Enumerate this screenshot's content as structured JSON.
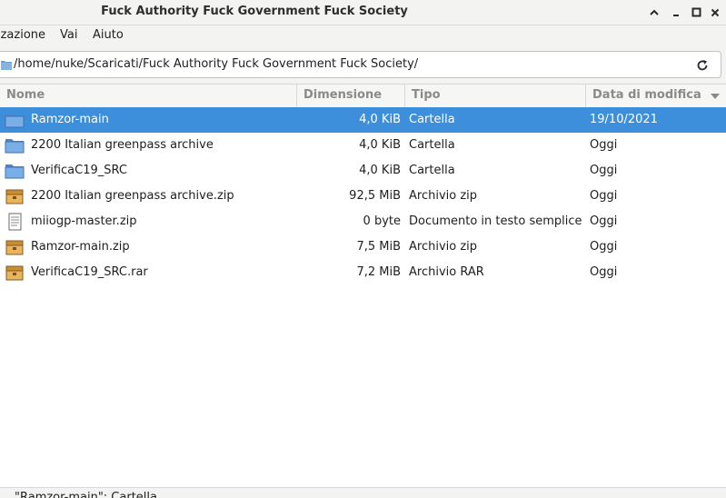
{
  "window": {
    "title": "Fuck Authority Fuck Government Fuck Society",
    "buttons": {
      "up": "⌃",
      "minimize": "–",
      "maximize": "□",
      "close": "✕"
    }
  },
  "menubar": {
    "items": [
      {
        "label": "izazione"
      },
      {
        "label": "Vai"
      },
      {
        "label": "Aiuto"
      }
    ]
  },
  "location": {
    "path": "/home/nuke/Scaricati/Fuck Authority Fuck Government Fuck Society/",
    "folder_icon": "folder-icon",
    "reload_icon": "reload-icon"
  },
  "columns": {
    "name": "Nome",
    "size": "Dimensione",
    "type": "Tipo",
    "date": "Data di modifica",
    "sort_column": "date",
    "sort_direction": "descending"
  },
  "files": [
    {
      "name": "Ramzor-main",
      "size": "4,0 KiB",
      "type": "Cartella",
      "date": "19/10/2021",
      "icon": "folder-icon",
      "selected": true
    },
    {
      "name": "2200 Italian greenpass archive",
      "size": "4,0 KiB",
      "type": "Cartella",
      "date": "Oggi",
      "icon": "folder-icon",
      "selected": false
    },
    {
      "name": "VerificaC19_SRC",
      "size": "4,0 KiB",
      "type": "Cartella",
      "date": "Oggi",
      "icon": "folder-icon",
      "selected": false
    },
    {
      "name": "2200 Italian greenpass archive.zip",
      "size": "92,5 MiB",
      "type": "Archivio zip",
      "date": "Oggi",
      "icon": "archive-icon",
      "selected": false
    },
    {
      "name": "miiogp-master.zip",
      "size": "0 byte",
      "type": "Documento in testo semplice",
      "date": "Oggi",
      "icon": "text-file-icon",
      "selected": false
    },
    {
      "name": "Ramzor-main.zip",
      "size": "7,5 MiB",
      "type": "Archivio zip",
      "date": "Oggi",
      "icon": "archive-icon",
      "selected": false
    },
    {
      "name": "VerificaC19_SRC.rar",
      "size": "7,2 MiB",
      "type": "Archivio RAR",
      "date": "Oggi",
      "icon": "archive-icon",
      "selected": false
    }
  ],
  "status": {
    "text": "\"Ramzor-main\": Cartella"
  },
  "colors": {
    "selection": "#3d8fdb",
    "folder": "#6d9ed6",
    "archive": "#e0a84a"
  }
}
